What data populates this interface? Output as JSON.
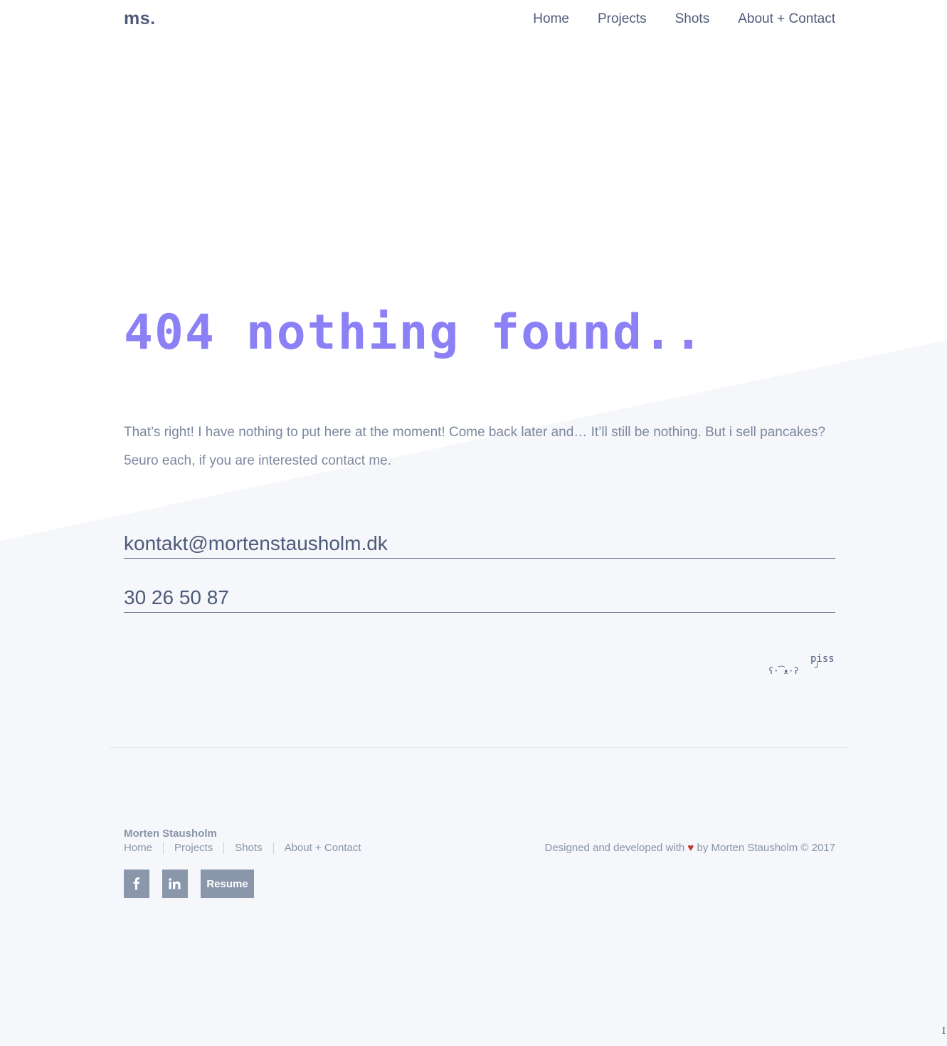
{
  "header": {
    "logo": "ms.",
    "nav": [
      {
        "label": "Home"
      },
      {
        "label": "Projects"
      },
      {
        "label": "Shots"
      },
      {
        "label": "About + Contact"
      }
    ]
  },
  "main": {
    "title": "404 nothing found..",
    "description": "That’s right! I have nothing to put here at the moment! Come back later and… It’ll still be nothing. But i sell pancakes? 5euro each, if you are interested contact me.",
    "email": "kontakt@mortenstausholm.dk",
    "phone": "30 26 50 87",
    "kaomoji": {
      "face": "ʕ·͡ᴥ·ʔ",
      "word": "piss",
      "drop": "╯"
    }
  },
  "footer": {
    "name": "Morten Stausholm",
    "nav": [
      {
        "label": "Home"
      },
      {
        "label": "Projects"
      },
      {
        "label": "Shots"
      },
      {
        "label": "About + Contact"
      }
    ],
    "credit_before": "Designed and developed with",
    "credit_heart": "♥",
    "credit_after": "by Morten Stausholm © 2017",
    "social": {
      "facebook_icon": "facebook-icon",
      "linkedin_icon": "linkedin-icon",
      "resume_label": "Resume"
    }
  },
  "colors": {
    "accent": "#8b80f5",
    "text": "#4e5a7a",
    "muted": "#8a94a8",
    "background_band": "#f5f7fa",
    "button": "#8a96aa",
    "heart": "#c0392b"
  },
  "cursor": "I"
}
